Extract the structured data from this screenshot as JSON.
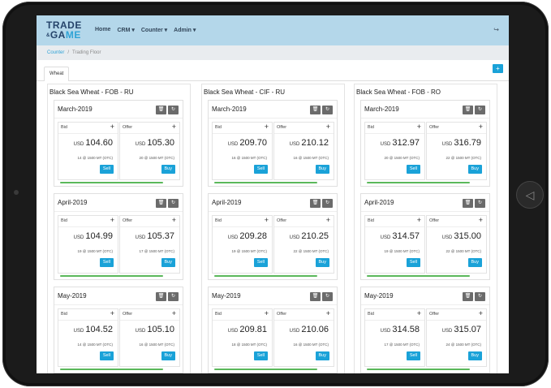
{
  "brand": {
    "line1": "TRADE",
    "amp": "&",
    "line2a": "GA",
    "line2b": "ME"
  },
  "nav": {
    "items": [
      "Home",
      "CRM ▾",
      "Counter ▾",
      "Admin ▾"
    ],
    "logout_icon": "logout-icon"
  },
  "breadcrumb": {
    "link": "Counter",
    "sep": "/",
    "current": "Trading Floor"
  },
  "tabs": {
    "active": "Wheat",
    "add": "+"
  },
  "labels": {
    "bid": "Bid",
    "offer": "Offer",
    "plus": "+",
    "sell": "Sell",
    "buy": "Buy",
    "currency": "USD"
  },
  "colors": {
    "navbar": "#b4d7ea",
    "accent": "#1aa2d8",
    "progress": "#5bb85b"
  },
  "markets": [
    {
      "title": "Black Sea Wheat - FOB - RU",
      "rows": [
        {
          "month": "March-2019",
          "bid": "104.60",
          "bid_meta": "14 @ 1500 MT (OTC)",
          "offer": "105.30",
          "offer_meta": "20 @ 1500 MT (OTC)"
        },
        {
          "month": "April-2019",
          "bid": "104.99",
          "bid_meta": "19 @ 1500 MT (OTC)",
          "offer": "105.37",
          "offer_meta": "17 @ 1500 MT (OTC)"
        },
        {
          "month": "May-2019",
          "bid": "104.52",
          "bid_meta": "14 @ 1500 MT (OTC)",
          "offer": "105.10",
          "offer_meta": "16 @ 1500 MT (OTC)"
        }
      ]
    },
    {
      "title": "Black Sea Wheat - CIF - RU",
      "rows": [
        {
          "month": "March-2019",
          "bid": "209.70",
          "bid_meta": "16 @ 1500 MT (OTC)",
          "offer": "210.12",
          "offer_meta": "16 @ 1500 MT (OTC)"
        },
        {
          "month": "April-2019",
          "bid": "209.28",
          "bid_meta": "19 @ 1500 MT (OTC)",
          "offer": "210.25",
          "offer_meta": "22 @ 1500 MT (OTC)"
        },
        {
          "month": "May-2019",
          "bid": "209.81",
          "bid_meta": "18 @ 1500 MT (OTC)",
          "offer": "210.06",
          "offer_meta": "16 @ 1500 MT (OTC)"
        }
      ]
    },
    {
      "title": "Black Sea Wheat - FOB - RO",
      "rows": [
        {
          "month": "March-2019",
          "bid": "312.97",
          "bid_meta": "20 @ 1500 MT (OTC)",
          "offer": "316.79",
          "offer_meta": "22 @ 1500 MT (OTC)"
        },
        {
          "month": "April-2019",
          "bid": "314.57",
          "bid_meta": "19 @ 1500 MT (OTC)",
          "offer": "315.00",
          "offer_meta": "22 @ 1500 MT (OTC)"
        },
        {
          "month": "May-2019",
          "bid": "314.58",
          "bid_meta": "17 @ 1500 MT (OTC)",
          "offer": "315.07",
          "offer_meta": "24 @ 1500 MT (OTC)"
        }
      ]
    }
  ]
}
